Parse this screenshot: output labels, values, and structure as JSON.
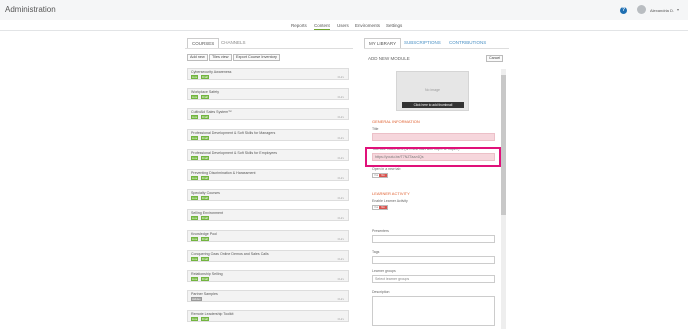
{
  "app": {
    "title": "Administration"
  },
  "header": {
    "user_name": "Alexandria D.",
    "help": "?",
    "chevron": "▾"
  },
  "nav": {
    "items": [
      "Reports",
      "Content",
      "Users",
      "Enviroments",
      "Settings"
    ],
    "active": "Content"
  },
  "left": {
    "tabs": [
      "COURSES",
      "CHANNELS"
    ],
    "active_tab": "COURSES",
    "buttons": [
      "Add new",
      "Tiles view",
      "Export Course Inventory"
    ],
    "badge_labels": {
      "live": "Live",
      "draft": "Draft",
      "hidden": "Hidden"
    },
    "courses": [
      {
        "name": "Cybersecurity Awareness",
        "badges": [
          "live",
          "draft"
        ],
        "hours": "0Hrs"
      },
      {
        "name": "Workplace Safety",
        "badges": [
          "live",
          "draft"
        ],
        "hours": "0Hrs"
      },
      {
        "name": "CultivAid Sales System™",
        "badges": [
          "live",
          "draft"
        ],
        "hours": "0Hrs"
      },
      {
        "name": "Professional Development & Soft Skills for Managers",
        "badges": [
          "live",
          "draft"
        ],
        "hours": "0Hrs"
      },
      {
        "name": "Professional Development & Soft Skills for Employees",
        "badges": [
          "live",
          "draft"
        ],
        "hours": "0Hrs"
      },
      {
        "name": "Preventing Discrimination & Harassment",
        "badges": [
          "live",
          "draft"
        ],
        "hours": "0Hrs"
      },
      {
        "name": "Specialty Courses",
        "badges": [
          "live",
          "draft"
        ],
        "hours": "0Hrs"
      },
      {
        "name": "Selling Environment",
        "badges": [
          "live",
          "draft"
        ],
        "hours": "0Hrs"
      },
      {
        "name": "Knowledge Pool",
        "badges": [
          "live",
          "draft"
        ],
        "hours": "0Hrs"
      },
      {
        "name": "Conquering Ozas Online Demos and Sales Calls",
        "badges": [
          "live",
          "draft"
        ],
        "hours": "0Hrs"
      },
      {
        "name": "Relationship Selling",
        "badges": [
          "live",
          "draft"
        ],
        "hours": "0Hrs"
      },
      {
        "name": "Partner Samples",
        "badges": [
          "hidden"
        ],
        "hours": "0Hrs"
      },
      {
        "name": "Remote Leadership Toolkit",
        "badges": [
          "live",
          "draft"
        ],
        "hours": "0Hrs"
      }
    ]
  },
  "right": {
    "tabs": [
      "MY LIBRARY",
      "SUBSCRIPTIONS",
      "CONTRIBUTIONS"
    ],
    "active_tab": "MY LIBRARY",
    "form_title": "ADD NEW MODULE",
    "cancel": "Cancel",
    "thumbnail": {
      "no_image": "No image",
      "button": "Click here to add thumbnail"
    },
    "general_heading": "GENERAL INFORMATION",
    "title_label": "Title",
    "title_value": "",
    "youtube_label": "YouTube Video URL (url must start with http:// or https://)",
    "youtube_value": "https://youtu.be/T7NZTazz4Qs",
    "new_tab_label": "Open in a new tab",
    "learner_heading": "LEARNER ACTIVITY",
    "enable_label": "Enable Learner Activity",
    "toggle": {
      "yes": "Yes",
      "no": "No"
    },
    "presenters_label": "Presenters",
    "presenters_value": "",
    "tags_label": "Tags",
    "tags_value": "",
    "groups_label": "Learner groups",
    "groups_placeholder": "Select learner groups",
    "description_label": "Description"
  },
  "colors": {
    "accent_green": "#72b53f",
    "highlight": "#e0117a",
    "section_heading": "#e06030",
    "help_blue": "#1f6fb2"
  }
}
